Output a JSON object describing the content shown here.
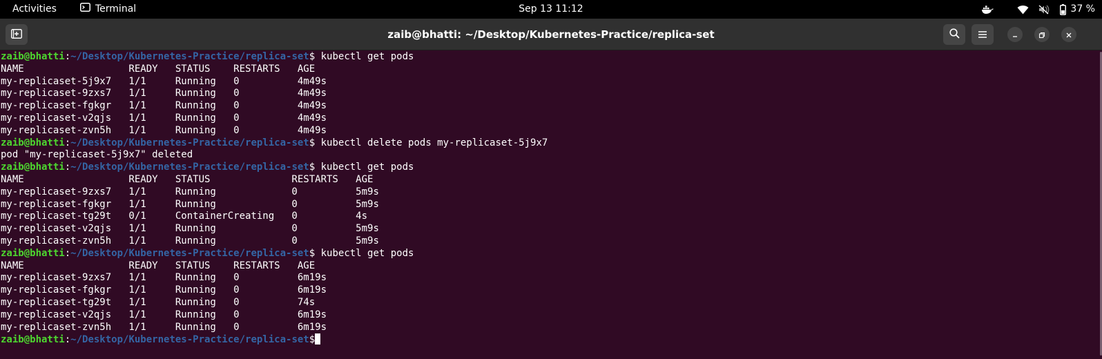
{
  "topbar": {
    "activities": "Activities",
    "app_name": "Terminal",
    "clock": "Sep 13  11:12",
    "battery": "37 %"
  },
  "window": {
    "title": "zaib@bhatti: ~/Desktop/Kubernetes-Practice/replica-set"
  },
  "colors": {
    "background": "#300a24",
    "user_host": "#4dd62f",
    "path": "#3465a4",
    "text": "#ffffff"
  },
  "icons": [
    "new-tab-icon",
    "search-icon",
    "hamburger-menu-icon",
    "minimize-icon",
    "restore-icon",
    "close-icon",
    "terminal-app-icon",
    "docker-icon",
    "wifi-icon",
    "volume-muted-icon",
    "battery-icon"
  ],
  "terminal": {
    "user_host": "zaib@bhatti",
    "path": "~/Desktop/Kubernetes-Practice/replica-set",
    "lines": [
      {
        "type": "prompt",
        "cmd": " kubectl get pods"
      },
      {
        "type": "out",
        "text": "NAME                  READY   STATUS    RESTARTS   AGE"
      },
      {
        "type": "out",
        "text": "my-replicaset-5j9x7   1/1     Running   0          4m49s"
      },
      {
        "type": "out",
        "text": "my-replicaset-9zxs7   1/1     Running   0          4m49s"
      },
      {
        "type": "out",
        "text": "my-replicaset-fgkgr   1/1     Running   0          4m49s"
      },
      {
        "type": "out",
        "text": "my-replicaset-v2qjs   1/1     Running   0          4m49s"
      },
      {
        "type": "out",
        "text": "my-replicaset-zvn5h   1/1     Running   0          4m49s"
      },
      {
        "type": "prompt",
        "cmd": " kubectl delete pods my-replicaset-5j9x7"
      },
      {
        "type": "out",
        "text": "pod \"my-replicaset-5j9x7\" deleted"
      },
      {
        "type": "prompt",
        "cmd": " kubectl get pods"
      },
      {
        "type": "out",
        "text": "NAME                  READY   STATUS              RESTARTS   AGE"
      },
      {
        "type": "out",
        "text": "my-replicaset-9zxs7   1/1     Running             0          5m9s"
      },
      {
        "type": "out",
        "text": "my-replicaset-fgkgr   1/1     Running             0          5m9s"
      },
      {
        "type": "out",
        "text": "my-replicaset-tg29t   0/1     ContainerCreating   0          4s"
      },
      {
        "type": "out",
        "text": "my-replicaset-v2qjs   1/1     Running             0          5m9s"
      },
      {
        "type": "out",
        "text": "my-replicaset-zvn5h   1/1     Running             0          5m9s"
      },
      {
        "type": "prompt",
        "cmd": " kubectl get pods"
      },
      {
        "type": "out",
        "text": "NAME                  READY   STATUS    RESTARTS   AGE"
      },
      {
        "type": "out",
        "text": "my-replicaset-9zxs7   1/1     Running   0          6m19s"
      },
      {
        "type": "out",
        "text": "my-replicaset-fgkgr   1/1     Running   0          6m19s"
      },
      {
        "type": "out",
        "text": "my-replicaset-tg29t   1/1     Running   0          74s"
      },
      {
        "type": "out",
        "text": "my-replicaset-v2qjs   1/1     Running   0          6m19s"
      },
      {
        "type": "out",
        "text": "my-replicaset-zvn5h   1/1     Running   0          6m19s"
      },
      {
        "type": "prompt",
        "cmd": ""
      }
    ]
  }
}
